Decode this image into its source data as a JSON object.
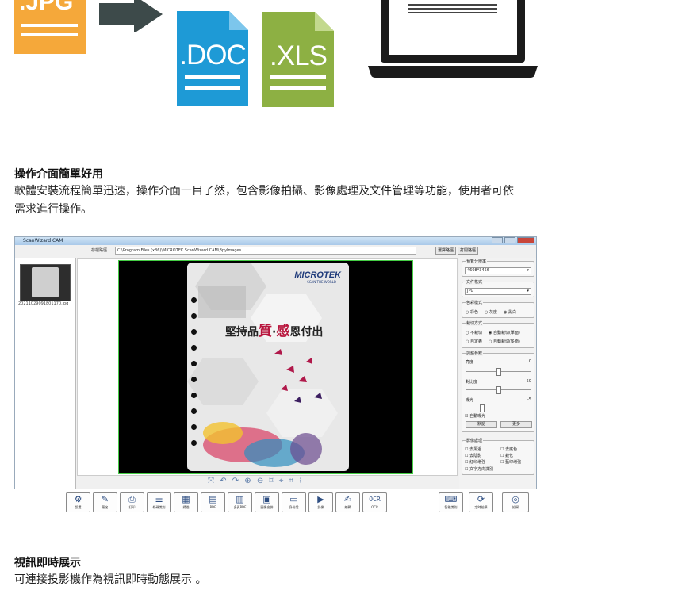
{
  "illustration": {
    "jpg_label": ".JPG",
    "doc_label": ".DOC",
    "xls_label": ".XLS",
    "colors": {
      "jpg": "#f5a83a",
      "doc": "#1e9ad6",
      "xls": "#8db043",
      "arrow": "#3d4a4a",
      "laptop": "#1b1b1b"
    }
  },
  "section1": {
    "heading": "操作介面簡單好用",
    "body_line1": "軟體安裝流程簡單迅速，操作介面一目了然，包含影像拍攝、影像處理及文件管理等功能，使用者可依",
    "body_line2": "需求進行操作。"
  },
  "app": {
    "title": "ScanWizard CAM",
    "path_label": "存檔路徑",
    "path_value": "C:\\Program Files (x86)\\MICROTEK ScanWizard CAM\\Bpylmages",
    "btn_browse": "選擇路徑",
    "btn_open": "打開路徑",
    "thumb_name": "20211029091801170.jpg",
    "brochure": {
      "brand": "MICROTEK",
      "brand_sub": "SCAN THE WORLD",
      "slogan_a": "堅持品",
      "slogan_b": "質",
      "slogan_c": "·",
      "slogan_d": "感",
      "slogan_e": "恩付出"
    },
    "preview_tools": "⤧ ↶ ↷ ⊕ ⊖ ⌑ ⌖ ⌗ ⁝",
    "panel": {
      "resolution_title": "預覽分辨率",
      "resolution_value": "4608*3456",
      "format_title": "文件格式",
      "format_value": "JPG",
      "color_title": "色彩模式",
      "color_opts": [
        "○ 彩色",
        "○ 灰度",
        "◉ 黑白"
      ],
      "cut_title": "裁切方式",
      "cut_opts": [
        "○ 不裁切",
        "◉ 自動裁切(單面)",
        "○ 自定義",
        "○ 自動裁切(多面)"
      ],
      "adjust_title": "調整參數",
      "brightness_label": "亮度",
      "brightness_value": "0",
      "contrast_label": "對比度",
      "contrast_value": "50",
      "exposure_label": "曝光",
      "exposure_value": "-5",
      "auto_exposure": "☑ 自動曝光",
      "btn_default": "默認",
      "btn_more": "更多",
      "process_title": "影像處理",
      "process_opts": [
        "☐ 去黑邊",
        "☐ 去底色",
        "☐ 去陰影",
        "☐ 銳化",
        "☐ 紅印增強",
        "☐ 藍印增強",
        "☐ 文字方向識別"
      ]
    },
    "toolbar": [
      {
        "icon": "⚙",
        "label": "設置",
        "name": "settings"
      },
      {
        "icon": "✎",
        "label": "簽名",
        "name": "sign"
      },
      {
        "icon": "⎙",
        "label": "打印",
        "name": "print"
      },
      {
        "icon": "☰",
        "label": "條碼識別",
        "name": "barcode"
      },
      {
        "icon": "▦",
        "label": "掃描",
        "name": "scan"
      },
      {
        "icon": "▤",
        "label": "PDF",
        "name": "pdf"
      },
      {
        "icon": "▥",
        "label": "多頁PDF",
        "name": "multi-pdf"
      },
      {
        "icon": "▣",
        "label": "圖像合併",
        "name": "merge"
      },
      {
        "icon": "▭",
        "label": "身份證",
        "name": "id-card"
      },
      {
        "icon": "▶",
        "label": "錄像",
        "name": "record"
      },
      {
        "icon": "✍",
        "label": "編輯",
        "name": "edit"
      },
      {
        "icon": "OCR",
        "label": "OCR",
        "name": "ocr"
      }
    ],
    "toolbar_right": [
      {
        "icon": "⌨",
        "label": "智能識別",
        "name": "smart"
      },
      {
        "icon": "⟳",
        "label": "定時拍攝",
        "name": "timer"
      },
      {
        "icon": "◎",
        "label": "拍攝",
        "name": "capture"
      }
    ]
  },
  "section2": {
    "heading": "視訊即時展示",
    "body": "可連接投影機作為視訊即時動態展示 。"
  }
}
